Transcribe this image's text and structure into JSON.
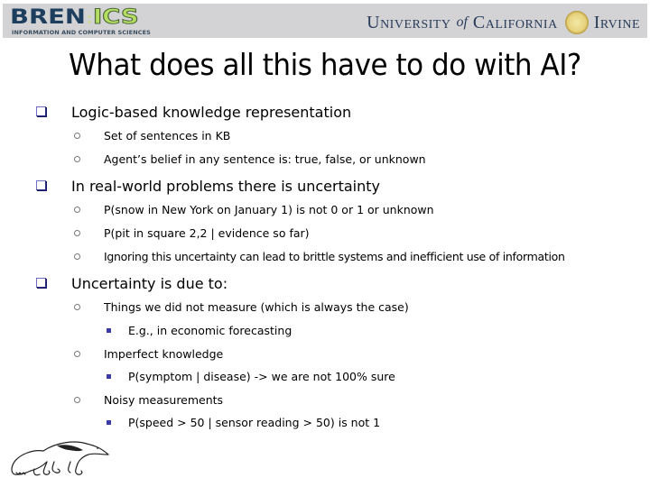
{
  "header": {
    "left_logo": {
      "part1": "BREN",
      "part2": ":",
      "part3": "ICS",
      "subtitle": "INFORMATION AND COMPUTER SCIENCES"
    },
    "right_logo": {
      "part1": "University",
      "part2": "of",
      "part3": "California",
      "part4": "Irvine"
    }
  },
  "slide": {
    "title": "What does all this have to do with AI?",
    "bullets": [
      {
        "text": "Logic-based knowledge representation",
        "children": [
          {
            "text": "Set of sentences in KB"
          },
          {
            "text": "Agent’s belief in any sentence is: true, false, or unknown"
          }
        ]
      },
      {
        "text": "In real-world problems there is uncertainty",
        "children": [
          {
            "text": "P(snow in New York on January 1) is not 0 or 1 or unknown"
          },
          {
            "text": "P(pit in square 2,2 | evidence so far)"
          },
          {
            "text": "Ignoring this uncertainty can lead to brittle systems and inefficient use of information"
          }
        ]
      },
      {
        "text": "Uncertainty is due to:",
        "children": [
          {
            "text": "Things we did not measure (which is always the case)",
            "children": [
              {
                "text": "E.g., in economic forecasting"
              }
            ]
          },
          {
            "text": "Imperfect knowledge",
            "children": [
              {
                "text": "P(symptom | disease) -> we are not 100% sure"
              }
            ]
          },
          {
            "text": "Noisy measurements",
            "children": [
              {
                "text": "P(speed > 50 | sensor reading > 50)  is not 1"
              }
            ]
          }
        ]
      }
    ]
  },
  "icons": {
    "level1": "checkbox-bullet-icon",
    "level2": "hollow-circle-bullet-icon",
    "level3": "square-bullet-icon",
    "footer": "anteater-mascot-icon"
  },
  "colors": {
    "header_bg": "#d3d3d6",
    "bren_blue": "#1e3e5e",
    "ics_green": "#b4dd62",
    "uci_navy": "#2a3b59",
    "bullet_blue": "#2b2a82"
  }
}
